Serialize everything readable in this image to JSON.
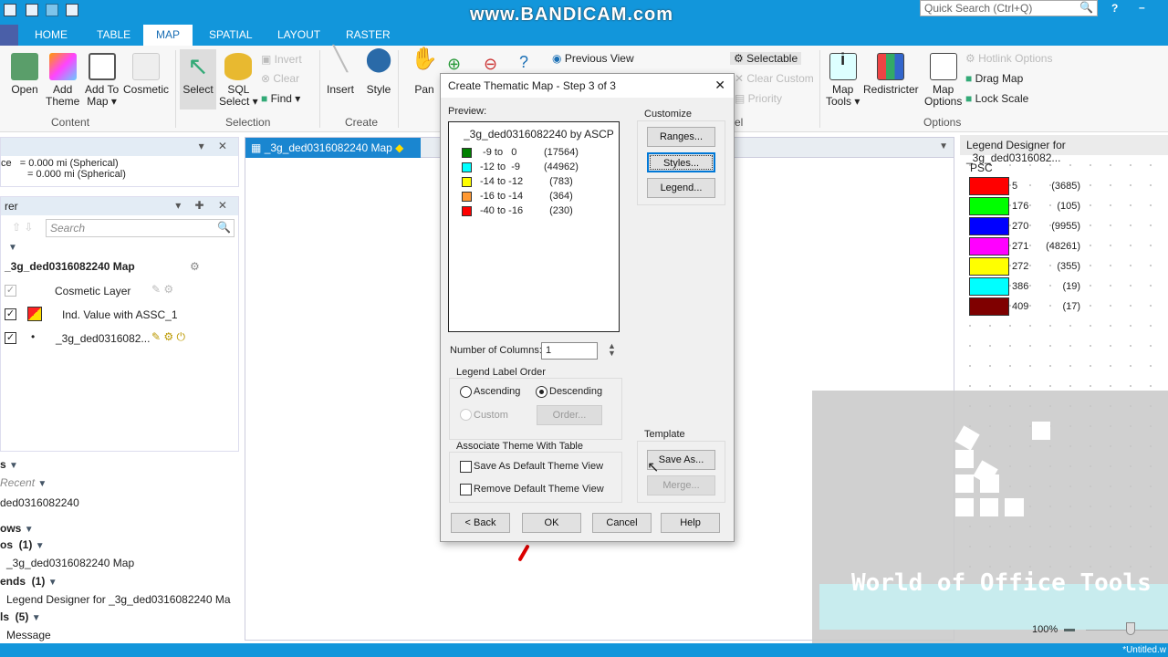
{
  "app": {
    "watermark": "www.BANDICAM.com",
    "quick_search_placeholder": "Quick Search (Ctrl+Q)",
    "help": "?",
    "minimize": "–"
  },
  "tabs": [
    {
      "label": "HOME"
    },
    {
      "label": "TABLE"
    },
    {
      "label": "MAP",
      "active": true
    },
    {
      "label": "SPATIAL"
    },
    {
      "label": "LAYOUT"
    },
    {
      "label": "RASTER"
    }
  ],
  "ribbon": {
    "content": {
      "label": "Content",
      "items": [
        "Open",
        "Add\nTheme",
        "Add To\nMap ▾",
        "Cosmetic"
      ]
    },
    "selection": {
      "label": "Selection",
      "select": "Select",
      "sql_select": "SQL\nSelect ▾",
      "invert": "Invert",
      "clear": "Clear",
      "find": "Find"
    },
    "create": {
      "label": "Create",
      "insert": "Insert",
      "style": "Style"
    },
    "pan": "Pan",
    "previous_view": "Previous View",
    "label_group": {
      "label": "el",
      "selectable": "Selectable",
      "clear_custom": "Clear Custom",
      "priority": "Priority"
    },
    "options": {
      "label": "Options",
      "map_tools": "Map\nTools ▾",
      "redistricter": "Redistricter",
      "map_options": "Map\nOptions",
      "hotlink_options": "Hotlink Options",
      "drag_map": "Drag Map",
      "lock_scale": "Lock Scale"
    }
  },
  "measure_panel": {
    "line1": "ce   = 0.000 mi (Spherical)",
    "line2": "= 0.000 mi (Spherical)"
  },
  "explorer": {
    "title": "rer",
    "search_placeholder": "Search",
    "map_name": "_3g_ded0316082240 Map",
    "layers": [
      {
        "label": "Cosmetic Layer",
        "checked": true,
        "disabled": true
      },
      {
        "label": "Ind. Value with ASSC_1",
        "checked": true
      },
      {
        "label": "_3g_ded0316082...",
        "checked": true
      }
    ]
  },
  "tables_panel": {
    "header": "s",
    "recent": "Recent",
    "table": "ded0316082240"
  },
  "windows_panel": {
    "header": "ows",
    "maps": "os  (1)",
    "map_item": "_3g_ded0316082240 Map",
    "legends": "ends  (1)",
    "legend_item": "Legend Designer for _3g_ded0316082240 Ma",
    "tools": "ls  (5)",
    "tool_item": "Message"
  },
  "map_window": {
    "tab": "_3g_ded0316082240 Map"
  },
  "legend_designer": {
    "title": "Legend Designer for _3g_ded0316082...",
    "heading": "PSC",
    "rows": [
      {
        "value": "5",
        "count": "(3685)",
        "color": "#ff0000"
      },
      {
        "value": "176",
        "count": "(105)",
        "color": "#00ff00"
      },
      {
        "value": "270",
        "count": "(9955)",
        "color": "#0000ff"
      },
      {
        "value": "271",
        "count": "(48261)",
        "color": "#ff00ff"
      },
      {
        "value": "272",
        "count": "(355)",
        "color": "#ffff00"
      },
      {
        "value": "386",
        "count": "(19)",
        "color": "#00ffff"
      },
      {
        "value": "409",
        "count": "(17)",
        "color": "#7f0000"
      }
    ]
  },
  "overlay": {
    "brand": "World of Office Tools",
    "zoom": "100%"
  },
  "status": {
    "doc": "*Untitled.w"
  },
  "dialog": {
    "title": "Create Thematic Map - Step 3 of 3",
    "close": "✕",
    "preview_label": "Preview:",
    "preview_title": "_3g_ded0316082240 by ASCP",
    "preview_rows": [
      {
        "range": " -9 to   0",
        "count": "(17564)",
        "color": "#008000"
      },
      {
        "range": "-12 to  -9",
        "count": "(44962)",
        "color": "#00ffff"
      },
      {
        "range": "-14 to -12",
        "count": "  (783)",
        "color": "#ffff00"
      },
      {
        "range": "-16 to -14",
        "count": "  (364)",
        "color": "#ff9933"
      },
      {
        "range": "-40 to -16",
        "count": "  (230)",
        "color": "#ff0000"
      }
    ],
    "customize": "Customize",
    "ranges": "Ranges...",
    "styles": "Styles...",
    "legend": "Legend...",
    "num_columns_label": "Number of Columns:",
    "num_columns": "1",
    "order_group": "Legend Label Order",
    "ascending": "Ascending",
    "descending": "Descending",
    "custom": "Custom",
    "order": "Order...",
    "order_selected": "Descending",
    "associate_group": "Associate Theme With Table",
    "save_default": "Save As Default Theme View",
    "remove_default": "Remove Default Theme View",
    "template": "Template",
    "save_as": "Save As...",
    "merge": "Merge...",
    "back": "< Back",
    "ok": "OK",
    "cancel": "Cancel",
    "help": "Help"
  }
}
